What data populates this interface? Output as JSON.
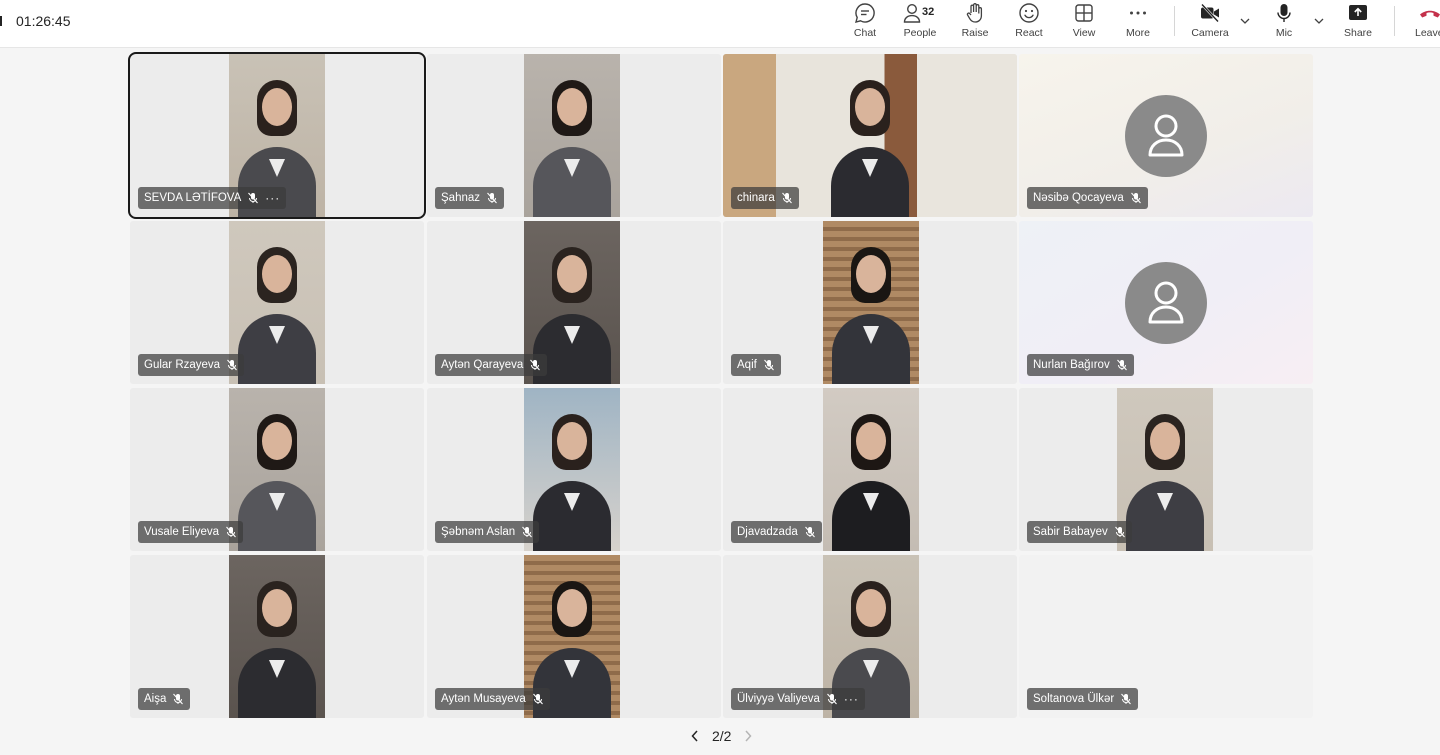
{
  "meeting": {
    "timer": "01:26:45",
    "people_count": "32"
  },
  "toolbar": {
    "chat": "Chat",
    "people": "People",
    "raise": "Raise",
    "react": "React",
    "view": "View",
    "more": "More",
    "camera": "Camera",
    "mic": "Mic",
    "share": "Share",
    "leave": "Leave"
  },
  "participants": [
    {
      "name": "SEVDA LƏTİFOVA",
      "muted": true,
      "active": true,
      "show_more": true,
      "video": "person"
    },
    {
      "name": "Şahnaz",
      "muted": true,
      "video": "person"
    },
    {
      "name": "chinara",
      "muted": true,
      "video": "wide"
    },
    {
      "name": "Nəsibə Qocayeva",
      "muted": true,
      "video": "avatar"
    },
    {
      "name": "Gular Rzayeva",
      "muted": true,
      "video": "person"
    },
    {
      "name": "Aytən Qarayeva",
      "muted": true,
      "video": "person"
    },
    {
      "name": "Aqif",
      "muted": true,
      "video": "person"
    },
    {
      "name": "Nurlan Bağırov",
      "muted": true,
      "video": "avatar"
    },
    {
      "name": "Vusale Eliyeva",
      "muted": true,
      "video": "person"
    },
    {
      "name": "Şəbnəm Aslan",
      "muted": true,
      "video": "person"
    },
    {
      "name": "Djavadzada",
      "muted": true,
      "video": "person"
    },
    {
      "name": "Sabir Babayev",
      "muted": true,
      "video": "person"
    },
    {
      "name": "Aişa",
      "muted": true,
      "video": "person"
    },
    {
      "name": "Aytən Musayeva",
      "muted": true,
      "video": "person"
    },
    {
      "name": "Ülviyyə Valiyeva",
      "muted": true,
      "show_more": true,
      "video": "person"
    },
    {
      "name": "Soltanova Ülkər",
      "muted": true,
      "video": "none"
    }
  ],
  "pagination": {
    "label": "2/2"
  },
  "colors": {
    "leave_red": "#c4314b",
    "active_border": "#1a1a1a",
    "name_tag_bg": "#3c3c3c"
  }
}
